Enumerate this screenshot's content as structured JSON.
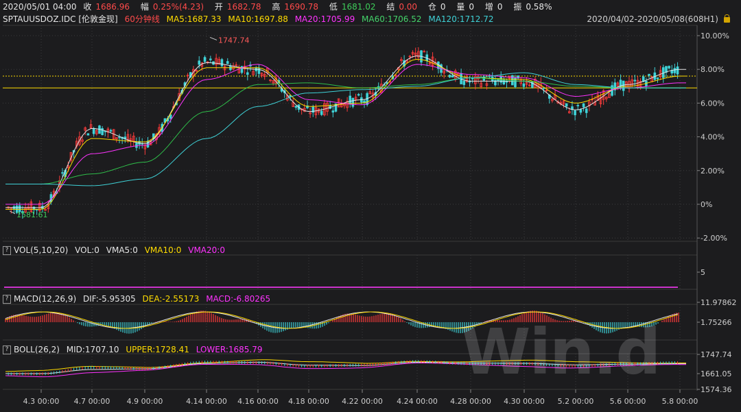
{
  "quote": {
    "datetime": "2020/05/01 04:00",
    "close_label": "收",
    "close_value": "1686.96",
    "change_label": "幅",
    "change_value": "0.25%(4.23)",
    "open_label": "开",
    "open_value": "1682.78",
    "high_label": "高",
    "high_value": "1690.78",
    "low_label": "低",
    "low_value": "1681.02",
    "settle_label": "结",
    "settle_value": "0.00",
    "oi_label": "仓",
    "oi_value": "0",
    "vol_label": "量",
    "vol_value": "0",
    "inc_label": "增",
    "inc_value": "0",
    "amp_label": "振",
    "amp_value": "0.58%"
  },
  "ma_bar": {
    "symbol": "SPTAUUSDOZ.IDC",
    "name": "[伦敦金现]",
    "period": "60分钟线",
    "ma5": "MA5:1687.33",
    "ma10": "MA10:1697.88",
    "ma20": "MA20:1705.99",
    "ma60": "MA60:1706.52",
    "ma120": "MA120:1712.72",
    "range": "2020/04/02-2020/05/08(608H1)"
  },
  "colors": {
    "ma5": "#e6e6e6",
    "ma10": "#ffdc00",
    "ma20": "#ff33ff",
    "ma60": "#2fbf4a",
    "ma120": "#3fd2d7",
    "up": "#ff3b3b",
    "down": "#3fd2d7",
    "grid": "#4a4a4a"
  },
  "main_chart": {
    "y_ticks": [
      "10.00%",
      "8.00%",
      "6.00%",
      "4.00%",
      "2.00%",
      "0%",
      "-2.00%"
    ],
    "y_tick_values": [
      10,
      8,
      6,
      4,
      2,
      0,
      -2
    ],
    "high_annotation": "1747.74",
    "low_annotation": "1581.61",
    "hline_dotted": 7.6,
    "hline_solid": 6.9
  },
  "vol_panel": {
    "header": "VOL(5,10,20)",
    "vol": "VOL:0",
    "vma5": "VMA5:0",
    "vma10": "VMA10:0",
    "vma20": "VMA20:0",
    "y_tick": "5"
  },
  "macd_panel": {
    "header": "MACD(12,26,9)",
    "dif": "DIF:-5.95305",
    "dea": "DEA:-2.55173",
    "macd": "MACD:-6.80265",
    "y_ticks": [
      "11.97862",
      "1.75266"
    ]
  },
  "boll_panel": {
    "header": "BOLL(26,2)",
    "mid": "MID:1707.10",
    "upper": "UPPER:1728.41",
    "lower": "LOWER:1685.79",
    "y_ticks": [
      "1747.74",
      "1661.05",
      "1574.36"
    ]
  },
  "x_axis": {
    "labels": [
      "4.3 00:00",
      "4.7 00:00",
      "4.9 00:00",
      "4.14 00:00",
      "4.16 00:00",
      "4.18 00:00",
      "4.22 00:00",
      "4.24 00:00",
      "4.28 00:00",
      "4.30 00:00",
      "5.2 00:00",
      "5.6 00:00",
      "5.8 00:00"
    ]
  },
  "chart_data": {
    "type": "line",
    "title": "SPTAUUSDOZ.IDC [伦敦金现] 60分钟线",
    "ylabel": "",
    "ylim": [
      -2,
      10
    ],
    "x": [
      "4.3 00:00",
      "4.7 00:00",
      "4.9 00:00",
      "4.14 00:00",
      "4.16 00:00",
      "4.18 00:00",
      "4.22 00:00",
      "4.24 00:00",
      "4.28 00:00",
      "4.30 00:00",
      "5.2 00:00",
      "5.6 00:00",
      "5.8 00:00"
    ],
    "series": [
      {
        "name": "MA5",
        "values": [
          -0.2,
          4.5,
          3.6,
          8.4,
          8.0,
          5.5,
          6.2,
          8.8,
          7.3,
          7.3,
          5.6,
          7.1,
          8.0
        ]
      },
      {
        "name": "MA10",
        "values": [
          -0.3,
          3.9,
          3.7,
          8.1,
          8.1,
          5.8,
          6.0,
          8.6,
          7.5,
          7.4,
          6.0,
          7.0,
          7.6
        ]
      },
      {
        "name": "MA20",
        "values": [
          0.0,
          3.0,
          3.5,
          7.4,
          8.3,
          6.2,
          5.9,
          8.3,
          7.7,
          7.5,
          6.4,
          6.9,
          7.2
        ]
      },
      {
        "name": "MA60",
        "values": [
          1.2,
          1.8,
          2.5,
          5.5,
          7.1,
          7.2,
          6.9,
          7.1,
          7.5,
          7.3,
          7.0,
          6.9,
          6.9
        ]
      },
      {
        "name": "MA120",
        "values": [
          1.2,
          1.1,
          1.5,
          3.9,
          5.8,
          6.6,
          6.8,
          7.0,
          7.5,
          7.8,
          7.1,
          6.9,
          6.9
        ]
      }
    ]
  }
}
